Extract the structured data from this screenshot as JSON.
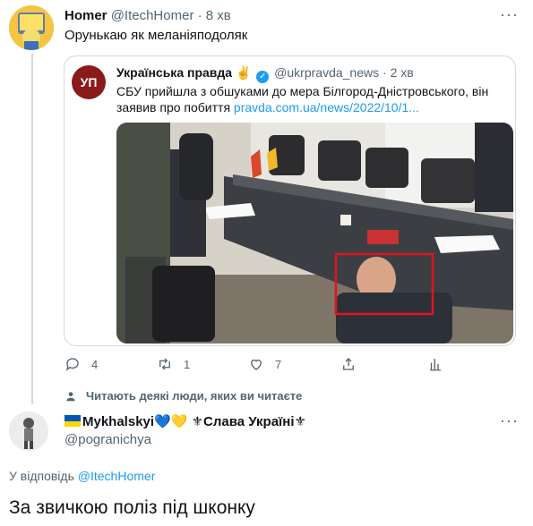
{
  "tweet1": {
    "name": "Homer",
    "handle": "@ItechHomer",
    "dot": "·",
    "time": "8 хв",
    "text": "Орунькаю як меланіяподоляк",
    "more": "···"
  },
  "quote": {
    "avatar_text": "УП",
    "name": "Українська правда ✌️",
    "handle": "@ukrpravda_news",
    "dot": "·",
    "time": "2 хв",
    "text": "СБУ прийшла з обшуками до мера Білгород-Дністровського, він заявив про побиття",
    "link": "pravda.com.ua/news/2022/10/1..."
  },
  "actions": {
    "replies": "4",
    "retweets": "1",
    "likes": "7"
  },
  "context": {
    "text": "Читають деякі люди, яких ви читаєте"
  },
  "tweet2": {
    "name_main": "Mykhalskyi💙💛",
    "name_slogan": "⚜Слава Україні⚜",
    "handle": "@pogranichya",
    "reply_prefix": "У відповідь",
    "reply_handle": "@ItechHomer",
    "text": "За звичкою поліз під шконку",
    "more": "···"
  },
  "colors": {
    "accent": "#1d9bf0",
    "muted": "#536471",
    "border": "#cfd9de",
    "highlight_box": "#e0141e"
  }
}
